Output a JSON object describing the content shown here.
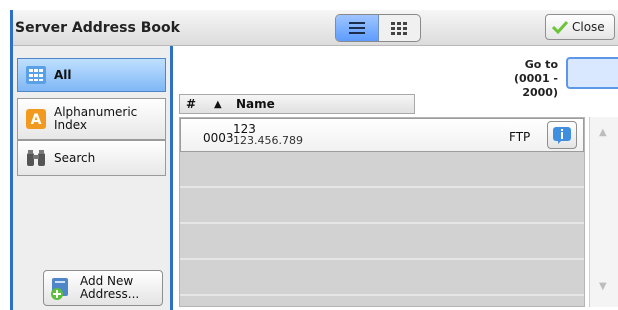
{
  "window": {
    "title": "Server Address Book",
    "close_label": "Close",
    "view_modes": [
      "list-view",
      "grid-view"
    ],
    "active_view": "list-view",
    "accent_color": "#2f6fc4"
  },
  "sidebar": {
    "items": [
      {
        "label": "All",
        "icon": "grid-icon",
        "selected": true
      },
      {
        "label": "Alphanumeric\nIndex",
        "icon": "letter-a-icon",
        "selected": false
      },
      {
        "label": "Search",
        "icon": "binoculars-icon",
        "selected": false
      }
    ],
    "add_button_label": "Add New\nAddress..."
  },
  "goto": {
    "label": "Go to",
    "range": "(0001 - 2000)",
    "value": ""
  },
  "table": {
    "columns": [
      "#",
      "Name"
    ],
    "sort_indicator": "▲",
    "rows": [
      {
        "number": "0003",
        "name": "123",
        "address": "123.456.789",
        "protocol": "FTP",
        "action_icon": "info-icon"
      }
    ],
    "empty_rows": 4
  },
  "scrollbar": {
    "up_glyph": "▲",
    "down_glyph": "▼"
  }
}
